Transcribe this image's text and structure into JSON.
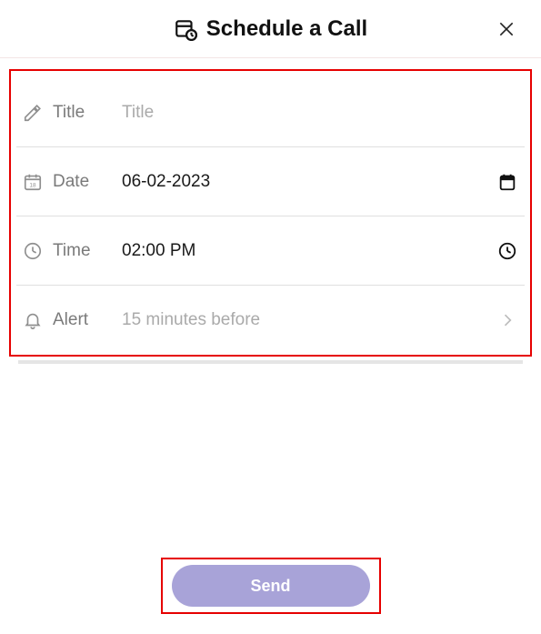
{
  "header": {
    "title": "Schedule a Call"
  },
  "form": {
    "title": {
      "label": "Title",
      "placeholder": "Title",
      "value": ""
    },
    "date": {
      "label": "Date",
      "value": "06-02-2023"
    },
    "time": {
      "label": "Time",
      "value": "02:00 PM"
    },
    "alert": {
      "label": "Alert",
      "value": "15 minutes before"
    }
  },
  "actions": {
    "send_label": "Send"
  }
}
